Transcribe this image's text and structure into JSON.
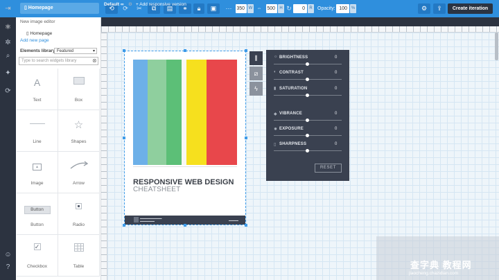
{
  "toolbar": {
    "page_select": "Homepage",
    "width_value": "350",
    "width_tag": "W",
    "height_value": "500",
    "height_tag": "H",
    "rotation_value": "0",
    "rotation_tag": "R",
    "opacity_label": "Opacity:",
    "opacity_value": "100",
    "opacity_tag": "%",
    "create_button": "Create iteration"
  },
  "page_menu": {
    "editor_title": "New image editor",
    "current_page": "Homepage",
    "add_page": "Add new page"
  },
  "library": {
    "label": "Elements library:",
    "selected": "Featured",
    "search_placeholder": "Type to search widgets library",
    "widgets": [
      {
        "label": "Text",
        "icon": "text-icon"
      },
      {
        "label": "Box",
        "icon": "box-icon"
      },
      {
        "label": "Line",
        "icon": "line-icon"
      },
      {
        "label": "Shapes",
        "icon": "star-icon"
      },
      {
        "label": "Image",
        "icon": "image-icon"
      },
      {
        "label": "Arrow",
        "icon": "arrow-icon"
      },
      {
        "label": "Button",
        "icon": "button-icon",
        "preview_text": "Button"
      },
      {
        "label": "Radio",
        "icon": "radio-icon"
      },
      {
        "label": "Checkbox",
        "icon": "checkbox-icon"
      },
      {
        "label": "Table",
        "icon": "table-icon"
      }
    ]
  },
  "tabs": {
    "default": "Default",
    "add_responsive": "+ Add responsive version"
  },
  "poster": {
    "title": "RESPONSIVE WEB DESIGN",
    "subtitle": "CHEATSHEET",
    "colors": [
      "#6db0e8",
      "#8fcf9e",
      "#5cbf77",
      "#f6e01e",
      "#e8474b"
    ]
  },
  "image_editor": {
    "filters": [
      {
        "label": "BRIGHTNESS",
        "value": "0",
        "icon": "sun-icon"
      },
      {
        "label": "CONTRAST",
        "value": "0",
        "icon": "contrast-icon"
      },
      {
        "label": "SATURATION",
        "value": "0",
        "icon": "drop-icon"
      },
      {
        "label": "VIBRANCE",
        "value": "0",
        "icon": "vibrance-icon"
      },
      {
        "label": "EXPOSURE",
        "value": "0",
        "icon": "exposure-icon"
      },
      {
        "label": "SHARPNESS",
        "value": "0",
        "icon": "sharpness-icon"
      }
    ],
    "reset_label": "RESET"
  },
  "watermark": {
    "main": "查字典 教程网",
    "sub": "jiaocheng.chazidian.com"
  }
}
